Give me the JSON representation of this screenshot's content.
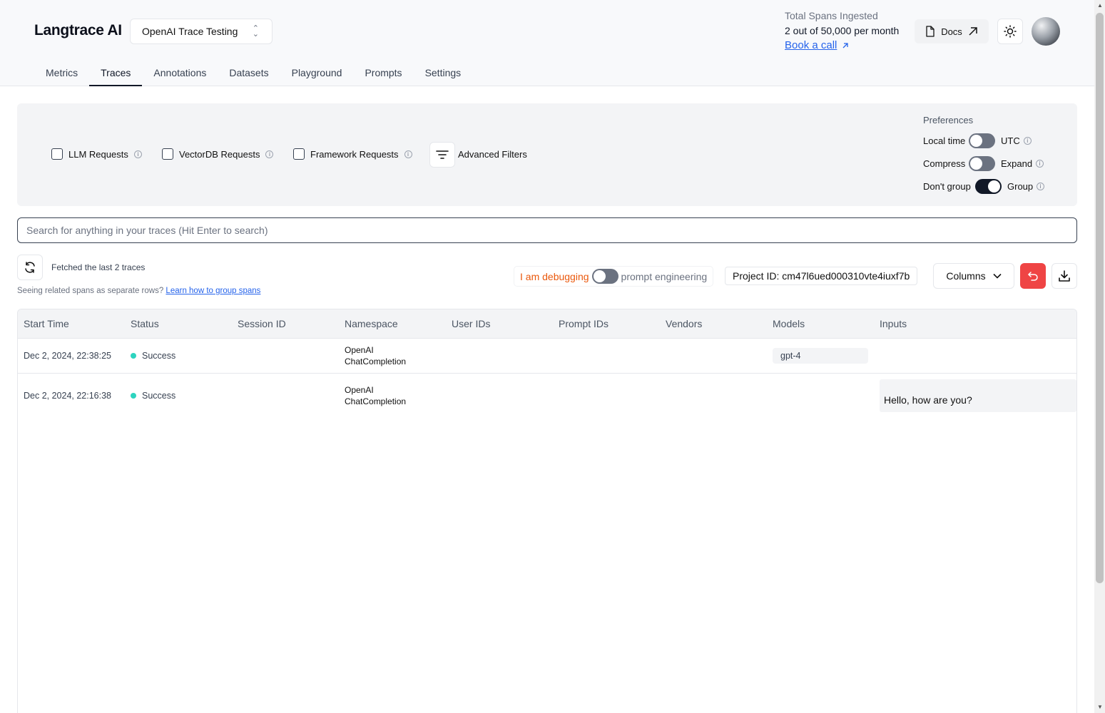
{
  "header": {
    "brand": "Langtrace AI",
    "project": "OpenAI Trace Testing",
    "spans_label": "Total Spans Ingested",
    "spans_value": "2 out of 50,000 per month",
    "book_call": "Book a call",
    "docs": "Docs"
  },
  "tabs": [
    "Metrics",
    "Traces",
    "Annotations",
    "Datasets",
    "Playground",
    "Prompts",
    "Settings"
  ],
  "active_tab": "Traces",
  "filters": {
    "llm": "LLM Requests",
    "vectordb": "VectorDB Requests",
    "framework": "Framework Requests",
    "advanced": "Advanced Filters"
  },
  "preferences": {
    "title": "Preferences",
    "time_left": "Local time",
    "time_right": "UTC",
    "compress_left": "Compress",
    "compress_right": "Expand",
    "group_left": "Don't group",
    "group_right": "Group",
    "time_on": false,
    "compress_on": false,
    "group_on": true
  },
  "search": {
    "placeholder": "Search for anything in your traces (Hit Enter to search)"
  },
  "toolbar": {
    "fetched": "Fetched the last 2 traces",
    "related_text": "Seeing related spans as separate rows?",
    "related_link": "Learn how to group spans",
    "debugging": "I am debugging",
    "prompt_engineering": "prompt engineering",
    "project_id": "Project ID: cm47l6ued000310vte4iuxf7b",
    "columns": "Columns"
  },
  "table": {
    "headers": [
      "Start Time",
      "Status",
      "Session ID",
      "Namespace",
      "User IDs",
      "Prompt IDs",
      "Vendors",
      "Models",
      "Inputs"
    ],
    "rows": [
      {
        "start_time": "Dec 2, 2024, 22:38:25",
        "status": "Success",
        "namespace_line1": "OpenAI",
        "namespace_line2": "ChatCompletion",
        "model": "gpt-4",
        "input": ""
      },
      {
        "start_time": "Dec 2, 2024, 22:16:38",
        "status": "Success",
        "namespace_line1": "OpenAI",
        "namespace_line2": "ChatCompletion",
        "model": "",
        "input": "Hello, how are you?"
      }
    ]
  },
  "colors": {
    "accent_red": "#ef4444",
    "success": "#2dd4bf",
    "link": "#2563eb",
    "debug": "#ea580c"
  }
}
